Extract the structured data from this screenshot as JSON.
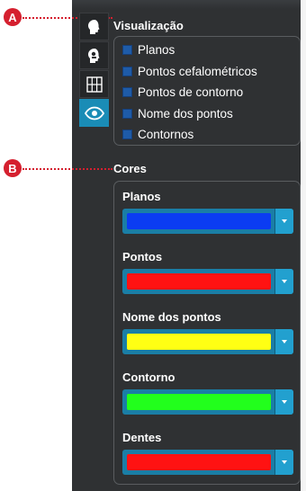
{
  "callouts": {
    "a": "A",
    "b": "B"
  },
  "icon_tabs": [
    "head-icon",
    "skull-profile-icon",
    "grid-icon",
    "eye-icon"
  ],
  "visualization": {
    "title": "Visualização",
    "items": [
      {
        "label": "Planos",
        "checked": true
      },
      {
        "label": "Pontos cefalométricos",
        "checked": true
      },
      {
        "label": "Pontos de contorno",
        "checked": true
      },
      {
        "label": "Nome dos pontos",
        "checked": true
      },
      {
        "label": "Contornos",
        "checked": true
      }
    ]
  },
  "colors": {
    "title": "Cores",
    "groups": [
      {
        "label": "Planos",
        "color": "#0b3cf2"
      },
      {
        "label": "Pontos",
        "color": "#ff1212"
      },
      {
        "label": "Nome dos pontos",
        "color": "#ffff14"
      },
      {
        "label": "Contorno",
        "color": "#22ff1c"
      },
      {
        "label": "Dentes",
        "color": "#ff1212"
      }
    ]
  },
  "theme": {
    "accent": "#1a8cb6",
    "panel_bg": "#2f3133",
    "callout": "#d5202f"
  }
}
